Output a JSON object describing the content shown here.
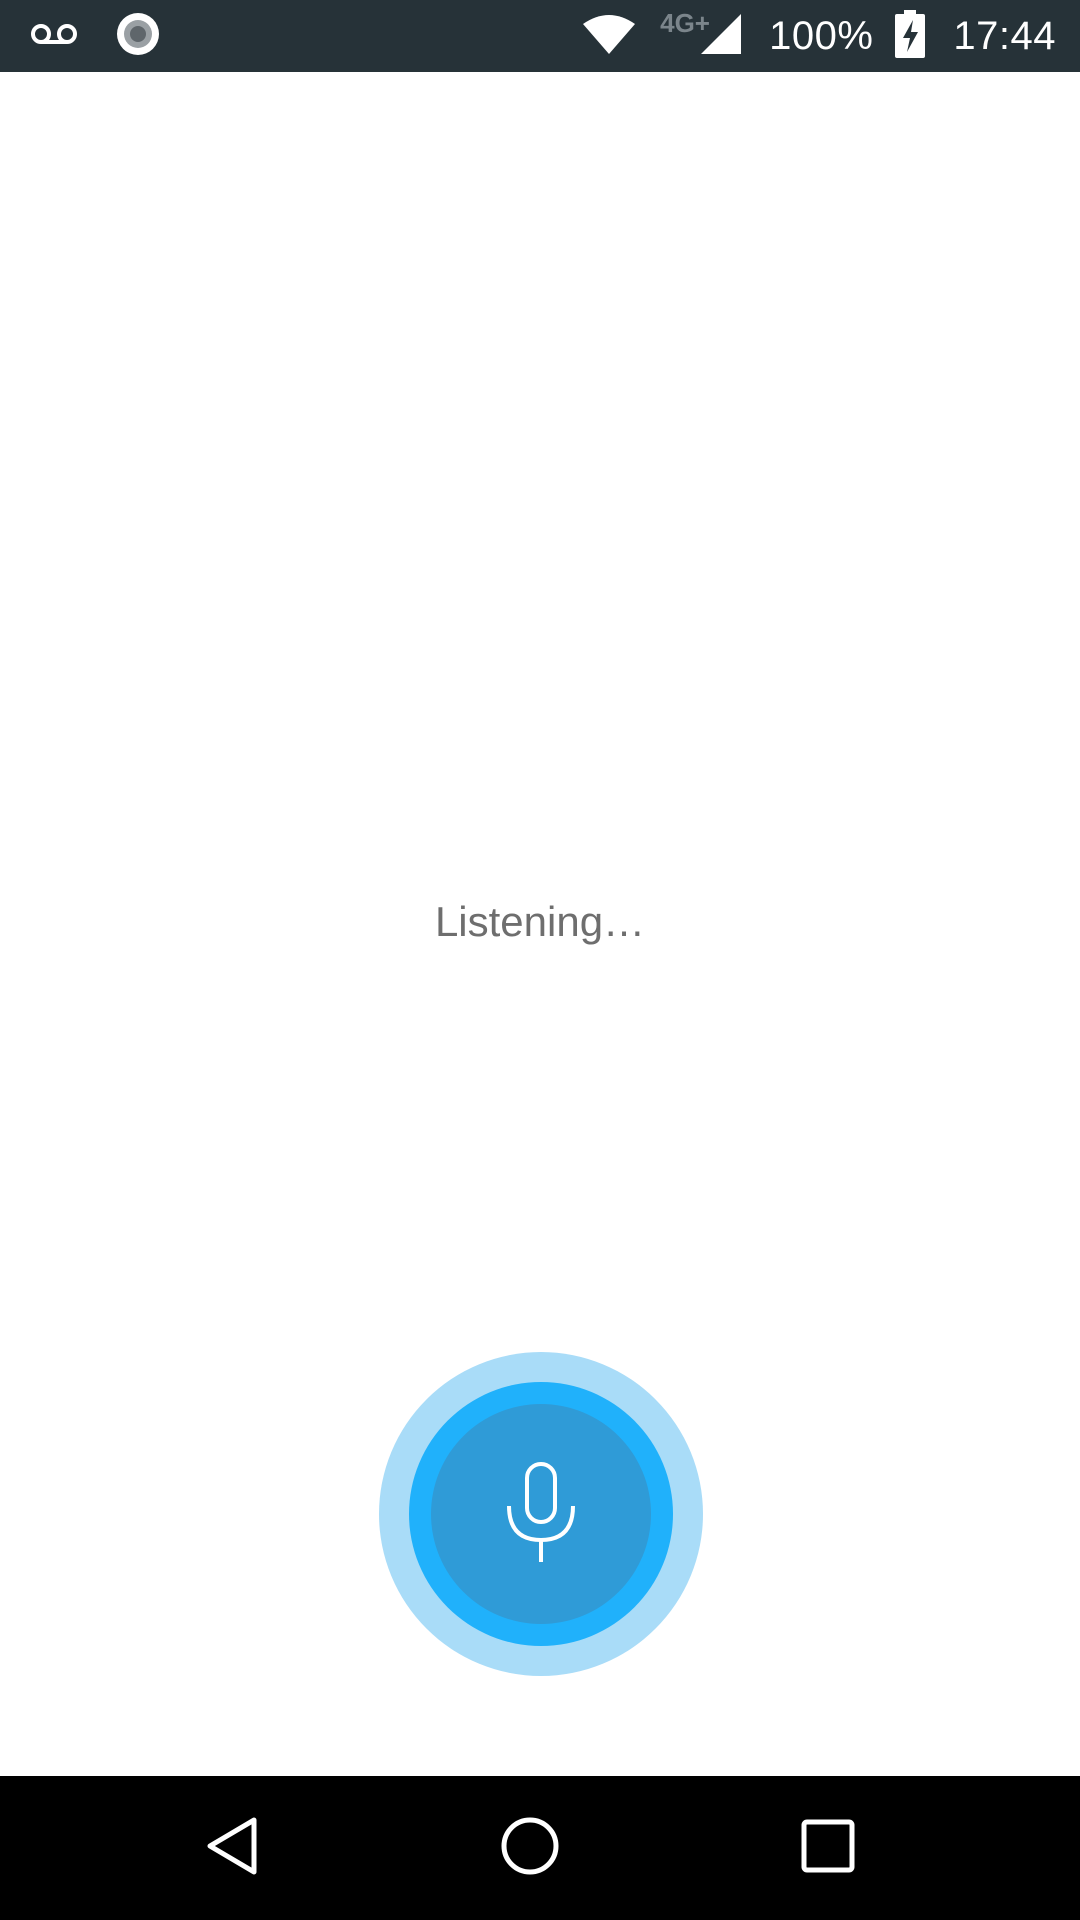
{
  "status_bar": {
    "left_icons": [
      "voicemail-icon",
      "record-icon"
    ],
    "network_type": "4G+",
    "battery_percent": "100%",
    "time": "17:44",
    "right_icons": [
      "wifi-icon",
      "cell-signal-icon",
      "battery-charging-icon"
    ]
  },
  "main": {
    "status_text": "Listening…",
    "mic_button_icon": "microphone-icon"
  },
  "nav_bar": {
    "buttons": [
      "back-icon",
      "home-icon",
      "recents-icon"
    ]
  },
  "colors": {
    "status_bar_bg": "#263238",
    "mic_outer": "#a9dcf8",
    "mic_ring": "#20b1fb",
    "mic_core": "#2f9bd7",
    "nav_bar_bg": "#000000"
  }
}
